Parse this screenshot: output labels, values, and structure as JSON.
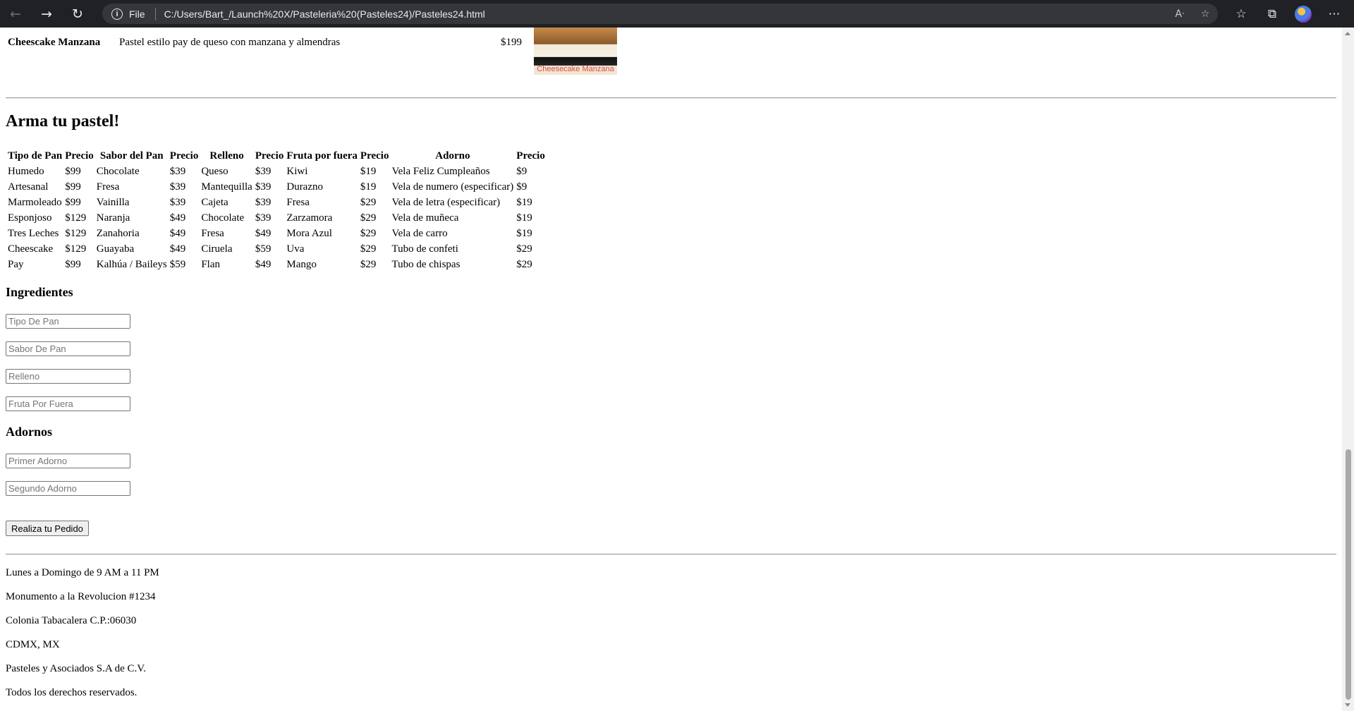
{
  "browser": {
    "file_label": "File",
    "url": "C:/Users/Bart_/Launch%20X/Pasteleria%20(Pasteles24)/Pasteles24.html"
  },
  "cake": {
    "name": "Cheescake Manzana",
    "description": "Pastel estilo pay de queso con manzana y almendras",
    "price": "$199",
    "image_label": "Cheesecake Manzana"
  },
  "builder": {
    "title": "Arma tu pastel!",
    "headers": [
      "Tipo de Pan",
      "Precio",
      "Sabor del Pan",
      "Precio",
      "Relleno",
      "Precio",
      "Fruta por fuera",
      "Precio",
      "Adorno",
      "Precio"
    ],
    "rows": [
      [
        "Humedo",
        "$99",
        "Chocolate",
        "$39",
        "Queso",
        "$39",
        "Kiwi",
        "$19",
        "Vela Feliz Cumpleaños",
        "$9"
      ],
      [
        "Artesanal",
        "$99",
        "Fresa",
        "$39",
        "Mantequilla",
        "$39",
        "Durazno",
        "$19",
        "Vela de numero (especificar)",
        "$9"
      ],
      [
        "Marmoleado",
        "$99",
        "Vainilla",
        "$39",
        "Cajeta",
        "$39",
        "Fresa",
        "$29",
        "Vela de letra (especificar)",
        "$19"
      ],
      [
        "Esponjoso",
        "$129",
        "Naranja",
        "$49",
        "Chocolate",
        "$39",
        "Zarzamora",
        "$29",
        "Vela de muñeca",
        "$19"
      ],
      [
        "Tres Leches",
        "$129",
        "Zanahoria",
        "$49",
        "Fresa",
        "$49",
        "Mora Azul",
        "$29",
        "Vela de carro",
        "$19"
      ],
      [
        "Cheescake",
        "$129",
        "Guayaba",
        "$49",
        "Ciruela",
        "$59",
        "Uva",
        "$29",
        "Tubo de confeti",
        "$29"
      ],
      [
        "Pay",
        "$99",
        "Kalhúa / Baileys",
        "$59",
        "Flan",
        "$49",
        "Mango",
        "$29",
        "Tubo de chispas",
        "$29"
      ]
    ]
  },
  "form": {
    "ingredients_title": "Ingredientes",
    "tipo_pan_placeholder": "Tipo De Pan",
    "sabor_pan_placeholder": "Sabor De Pan",
    "relleno_placeholder": "Relleno",
    "fruta_placeholder": "Fruta Por Fuera",
    "adornos_title": "Adornos",
    "primer_adorno_placeholder": "Primer Adorno",
    "segundo_adorno_placeholder": "Segundo Adorno",
    "submit_label": "Realiza tu Pedido"
  },
  "footer": {
    "hours": "Lunes a Domingo de 9 AM a 11 PM",
    "address": "Monumento a la Revolucion #1234",
    "colonia": "Colonia Tabacalera C.P.:06030",
    "city": "CDMX, MX",
    "company": "Pasteles y Asociados S.A de C.V.",
    "rights": "Todos los derechos reservados."
  }
}
